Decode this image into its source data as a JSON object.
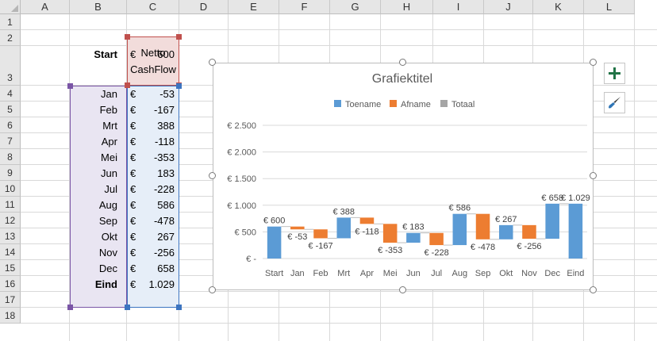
{
  "columns": [
    "A",
    "B",
    "C",
    "D",
    "E",
    "F",
    "G",
    "H",
    "I",
    "J",
    "K",
    "L"
  ],
  "rows": [
    "1",
    "2",
    "3",
    "4",
    "5",
    "6",
    "7",
    "8",
    "9",
    "10",
    "11",
    "12",
    "13",
    "14",
    "15",
    "16",
    "17",
    "18"
  ],
  "header_cell": {
    "line1": "Netto",
    "line2": "CashFlow"
  },
  "currency": "€",
  "table": [
    {
      "label": "Start",
      "value": "600"
    },
    {
      "label": "Jan",
      "value": "-53"
    },
    {
      "label": "Feb",
      "value": "-167"
    },
    {
      "label": "Mrt",
      "value": "388"
    },
    {
      "label": "Apr",
      "value": "-118"
    },
    {
      "label": "Mei",
      "value": "-353"
    },
    {
      "label": "Jun",
      "value": "183"
    },
    {
      "label": "Jul",
      "value": "-228"
    },
    {
      "label": "Aug",
      "value": "586"
    },
    {
      "label": "Sep",
      "value": "-478"
    },
    {
      "label": "Okt",
      "value": "267"
    },
    {
      "label": "Nov",
      "value": "-256"
    },
    {
      "label": "Dec",
      "value": "658"
    },
    {
      "label": "Eind",
      "value": "1.029"
    }
  ],
  "chart_buttons": {
    "add": "add-chart-element",
    "style": "chart-style-brush"
  },
  "colors": {
    "increase": "#5b9bd5",
    "decrease": "#ed7d31",
    "total": "#a5a5a5",
    "excel_green": "#217346"
  },
  "chart_data": {
    "type": "bar",
    "subtype": "waterfall",
    "title": "Grafiektitel",
    "categories": [
      "Start",
      "Jan",
      "Feb",
      "Mrt",
      "Apr",
      "Mei",
      "Jun",
      "Jul",
      "Aug",
      "Sep",
      "Okt",
      "Nov",
      "Dec",
      "Eind"
    ],
    "values": [
      600,
      -53,
      -167,
      388,
      -118,
      -353,
      183,
      -228,
      586,
      -478,
      267,
      -256,
      658,
      1029
    ],
    "data_labels": [
      "€ 600",
      "€ -53",
      "€ -167",
      "€ 388",
      "€ -118",
      "€ -353",
      "€ 183",
      "€ -228",
      "€ 586",
      "€ -478",
      "€ 267",
      "€ -256",
      "€ 658",
      "€ 1.029"
    ],
    "legend": [
      {
        "name": "Toename",
        "color": "#5b9bd5"
      },
      {
        "name": "Afname",
        "color": "#ed7d31"
      },
      {
        "name": "Totaal",
        "color": "#a5a5a5"
      }
    ],
    "legend_position": "top",
    "y_ticks": [
      {
        "value": 0,
        "label": "€ -"
      },
      {
        "value": 500,
        "label": "€ 500"
      },
      {
        "value": 1000,
        "label": "€ 1.000"
      },
      {
        "value": 1500,
        "label": "€ 1.500"
      },
      {
        "value": 2000,
        "label": "€ 2.000"
      },
      {
        "value": 2500,
        "label": "€ 2.500"
      }
    ],
    "ylim": [
      0,
      2500
    ],
    "grid": true
  }
}
